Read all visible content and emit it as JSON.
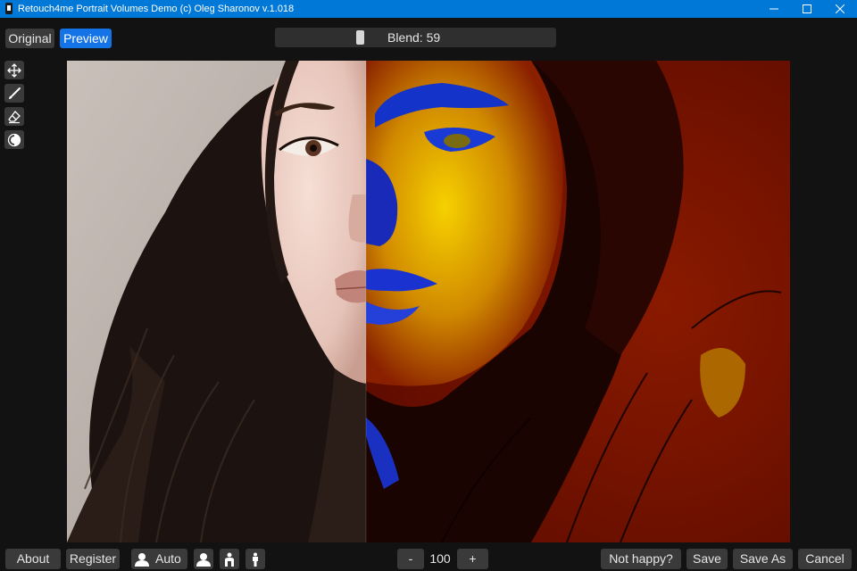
{
  "window": {
    "title": "Retouch4me Portrait Volumes Demo (c) Oleg Sharonov v.1.018",
    "controls": [
      "minimize-icon",
      "maximize-icon",
      "close-icon"
    ],
    "accent": "#0078d7"
  },
  "view_toggle": {
    "original_label": "Original",
    "preview_label": "Preview",
    "active": "Preview",
    "active_color": "#1473e6"
  },
  "blend": {
    "label": "Blend: 59",
    "value": 59
  },
  "tools": [
    {
      "icon": "move-icon"
    },
    {
      "icon": "brush-icon"
    },
    {
      "icon": "eraser-icon"
    },
    {
      "icon": "contrast-circle-icon"
    }
  ],
  "canvas": {
    "left_half": "original portrait",
    "right_half": "volume heatmap preview"
  },
  "bottom": {
    "about_label": "About",
    "register_label": "Register",
    "auto_label": "Auto",
    "zoom_minus_label": "-",
    "zoom_value": "100",
    "zoom_plus_label": "+",
    "not_happy_label": "Not happy?",
    "save_label": "Save",
    "save_as_label": "Save As",
    "cancel_label": "Cancel"
  }
}
